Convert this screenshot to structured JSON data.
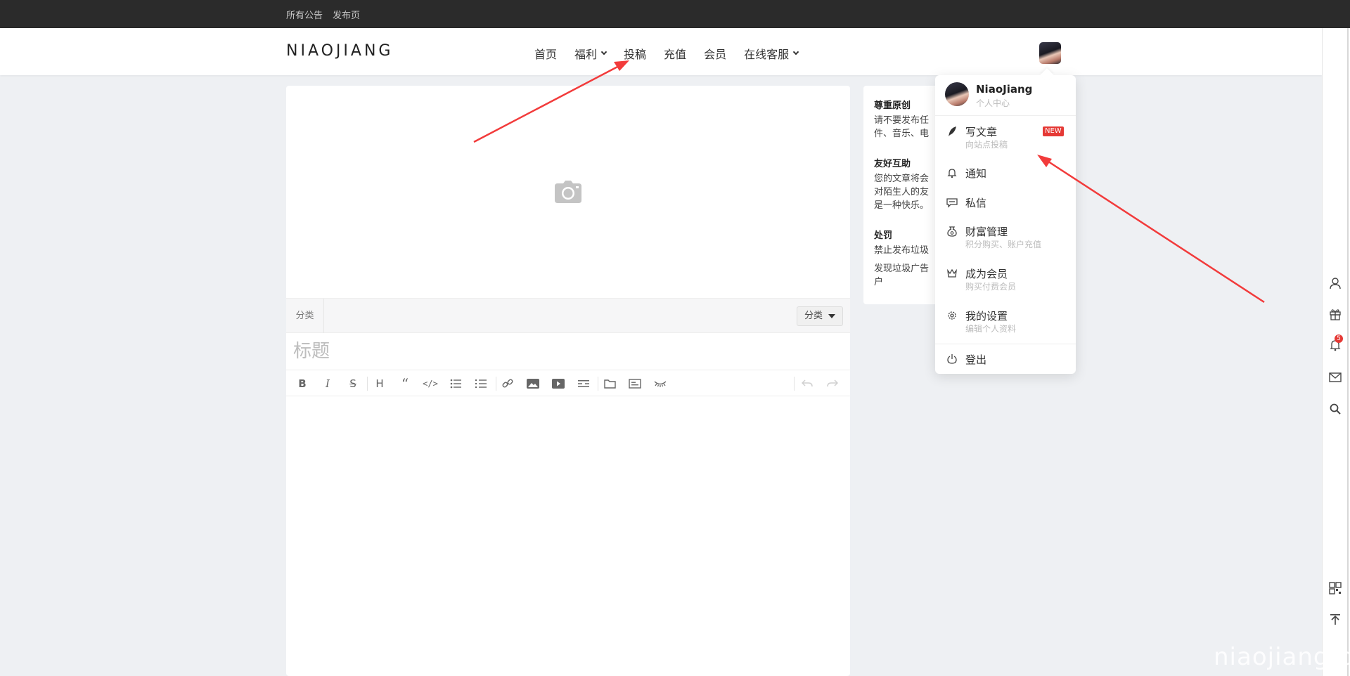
{
  "topbar": {
    "links": [
      "所有公告",
      "发布页"
    ]
  },
  "header": {
    "logo": "NIAOJIANG",
    "nav": [
      {
        "label": "首页",
        "dropdown": false
      },
      {
        "label": "福利",
        "dropdown": true
      },
      {
        "label": "投稿",
        "dropdown": false
      },
      {
        "label": "充值",
        "dropdown": false
      },
      {
        "label": "会员",
        "dropdown": false
      },
      {
        "label": "在线客服",
        "dropdown": true
      }
    ]
  },
  "editor": {
    "cover_icon": "camera-icon",
    "category_label": "分类",
    "category_select": "分类",
    "title_placeholder": "标题",
    "toolbar": [
      "bold",
      "italic",
      "strikethrough",
      "heading",
      "quote",
      "code",
      "unordered-list",
      "ordered-list",
      "link",
      "image",
      "video",
      "horizontal-rule",
      "folder",
      "card",
      "hide",
      "undo",
      "redo"
    ]
  },
  "side": {
    "sections": [
      {
        "heading": "尊重原创",
        "lines": [
          "请不要发布任",
          "件、音乐、电"
        ]
      },
      {
        "heading": "友好互助",
        "lines": [
          "您的文章将会",
          "对陌生人的友",
          "是一种快乐。"
        ]
      },
      {
        "heading": "处罚",
        "lines": [
          "禁止发布垃圾",
          "发现垃圾广告",
          "户"
        ]
      }
    ]
  },
  "dropdown": {
    "user_name": "NiaoJiang",
    "user_sub": "个人中心",
    "items": [
      {
        "label": "写文章",
        "sub": "向站点投稿",
        "icon": "feather-icon",
        "badge": "NEW"
      },
      {
        "label": "通知",
        "sub": "",
        "icon": "bell-icon"
      },
      {
        "label": "私信",
        "sub": "",
        "icon": "chat-icon"
      },
      {
        "label": "财富管理",
        "sub": "积分购买、账户充值",
        "icon": "money-bag-icon"
      },
      {
        "label": "成为会员",
        "sub": "购买付费会员",
        "icon": "crown-icon"
      },
      {
        "label": "我的设置",
        "sub": "编辑个人资料",
        "icon": "gear-icon"
      },
      {
        "label": "登出",
        "sub": "",
        "icon": "power-icon"
      }
    ]
  },
  "rail": {
    "notification_count": "5"
  },
  "watermark": "niaojiang.c",
  "colors": {
    "accent_red": "#e53935",
    "topbar": "#2b2b2b",
    "background": "#eef0f3"
  }
}
